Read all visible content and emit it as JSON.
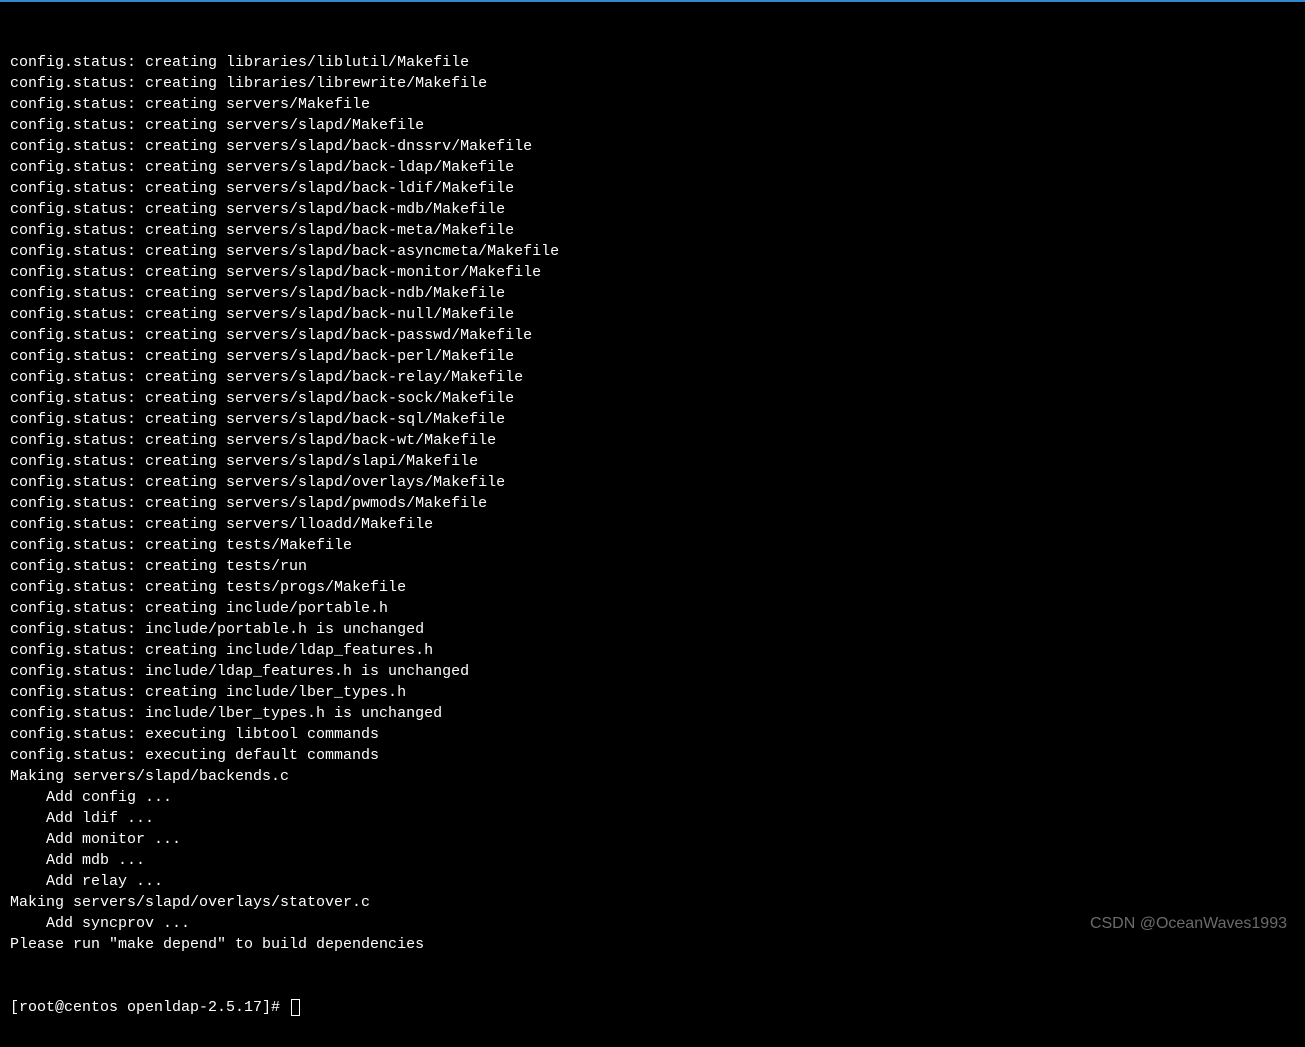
{
  "terminal": {
    "lines": [
      "config.status: creating libraries/liblutil/Makefile",
      "config.status: creating libraries/librewrite/Makefile",
      "config.status: creating servers/Makefile",
      "config.status: creating servers/slapd/Makefile",
      "config.status: creating servers/slapd/back-dnssrv/Makefile",
      "config.status: creating servers/slapd/back-ldap/Makefile",
      "config.status: creating servers/slapd/back-ldif/Makefile",
      "config.status: creating servers/slapd/back-mdb/Makefile",
      "config.status: creating servers/slapd/back-meta/Makefile",
      "config.status: creating servers/slapd/back-asyncmeta/Makefile",
      "config.status: creating servers/slapd/back-monitor/Makefile",
      "config.status: creating servers/slapd/back-ndb/Makefile",
      "config.status: creating servers/slapd/back-null/Makefile",
      "config.status: creating servers/slapd/back-passwd/Makefile",
      "config.status: creating servers/slapd/back-perl/Makefile",
      "config.status: creating servers/slapd/back-relay/Makefile",
      "config.status: creating servers/slapd/back-sock/Makefile",
      "config.status: creating servers/slapd/back-sql/Makefile",
      "config.status: creating servers/slapd/back-wt/Makefile",
      "config.status: creating servers/slapd/slapi/Makefile",
      "config.status: creating servers/slapd/overlays/Makefile",
      "config.status: creating servers/slapd/pwmods/Makefile",
      "config.status: creating servers/lloadd/Makefile",
      "config.status: creating tests/Makefile",
      "config.status: creating tests/run",
      "config.status: creating tests/progs/Makefile",
      "config.status: creating include/portable.h",
      "config.status: include/portable.h is unchanged",
      "config.status: creating include/ldap_features.h",
      "config.status: include/ldap_features.h is unchanged",
      "config.status: creating include/lber_types.h",
      "config.status: include/lber_types.h is unchanged",
      "config.status: executing libtool commands",
      "config.status: executing default commands",
      "Making servers/slapd/backends.c",
      "    Add config ...",
      "    Add ldif ...",
      "    Add monitor ...",
      "    Add mdb ...",
      "    Add relay ...",
      "Making servers/slapd/overlays/statover.c",
      "    Add syncprov ...",
      "Please run \"make depend\" to build dependencies"
    ],
    "prompt": "[root@centos openldap-2.5.17]# "
  },
  "watermark": "CSDN @OceanWaves1993"
}
